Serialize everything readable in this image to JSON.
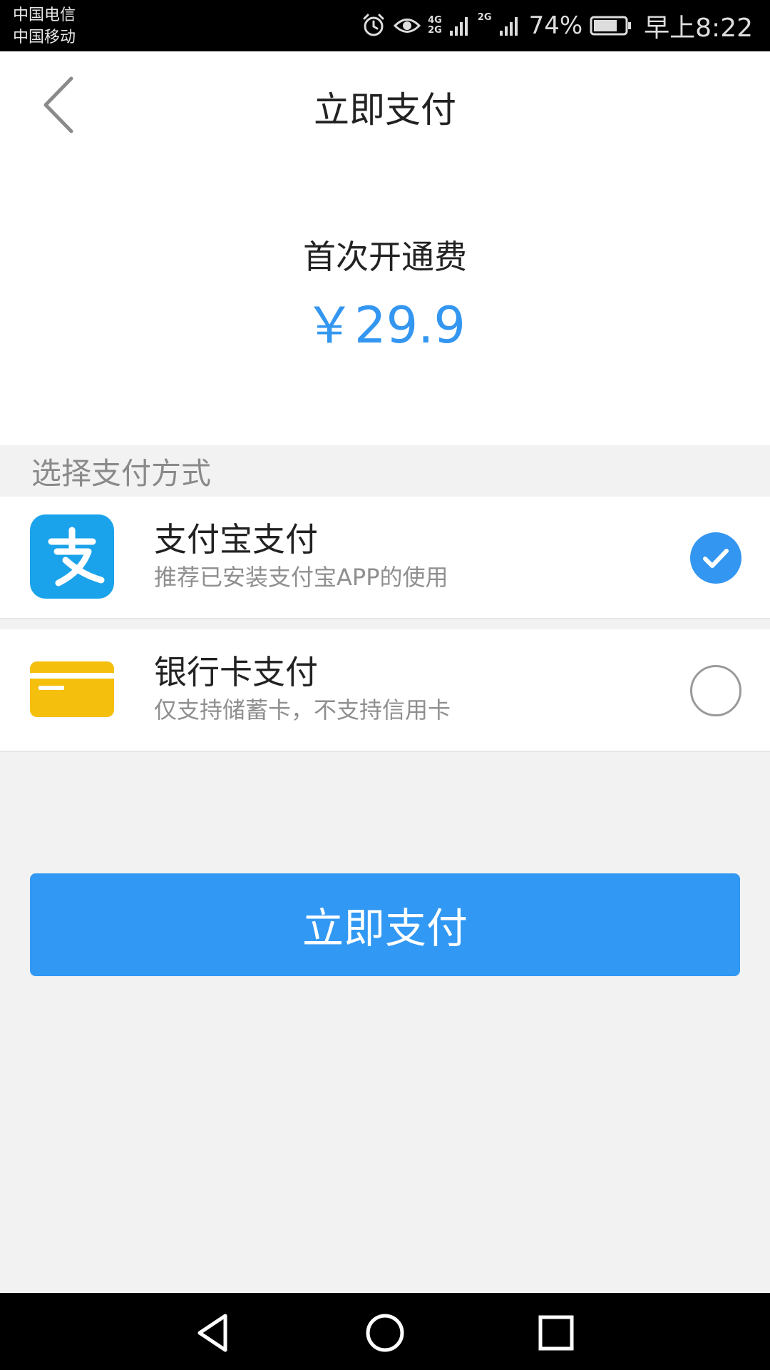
{
  "status_bar": {
    "carrier_1": "中国电信",
    "carrier_2": "中国移动",
    "signal_1_top": "4G",
    "signal_1_bottom": "2G",
    "signal_2": "2G",
    "battery_percent": "74%",
    "time": "早上8:22"
  },
  "header": {
    "title": "立即支付"
  },
  "amount": {
    "label": "首次开通费",
    "value": "￥29.9"
  },
  "payment": {
    "section_label": "选择支付方式",
    "options": [
      {
        "title": "支付宝支付",
        "description": "推荐已安装支付宝APP的使用",
        "icon": "alipay-icon",
        "selected": true
      },
      {
        "title": "银行卡支付",
        "description": "仅支持储蓄卡，不支持信用卡",
        "icon": "bank-card-icon",
        "selected": false
      }
    ]
  },
  "pay_button": {
    "label": "立即支付"
  },
  "colors": {
    "accent": "#3396f0",
    "alipay_blue": "#1aa3ea",
    "bank_card_yellow": "#f4bf0d"
  }
}
